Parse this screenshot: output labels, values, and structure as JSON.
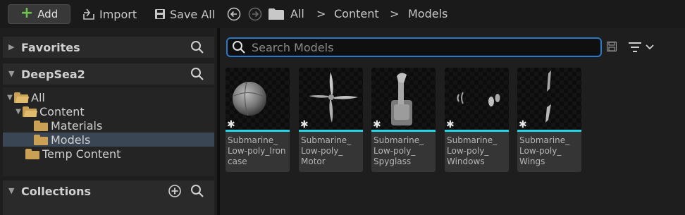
{
  "toolbar": {
    "add_label": "Add",
    "import_label": "Import",
    "save_all_label": "Save All",
    "breadcrumb": [
      "All",
      "Content",
      "Models"
    ],
    "separator": ">"
  },
  "left_panel": {
    "favorites_label": "Favorites",
    "project_label": "DeepSea2",
    "tree": [
      {
        "label": "All",
        "level": 0,
        "expanded": true,
        "selected": false
      },
      {
        "label": "Content",
        "level": 1,
        "expanded": true,
        "selected": false
      },
      {
        "label": "Materials",
        "level": 2,
        "expanded": false,
        "selected": false
      },
      {
        "label": "Models",
        "level": 2,
        "expanded": false,
        "selected": true
      },
      {
        "label": "Temp Content",
        "level": 1,
        "expanded": false,
        "selected": false
      }
    ],
    "collections_label": "Collections"
  },
  "content": {
    "search_placeholder": "Search Models",
    "assets": [
      {
        "name": "Submarine_\nLow-poly_Iron\ncase",
        "thumb": "sphere-icon"
      },
      {
        "name": "Submarine_\nLow-poly_\nMotor",
        "thumb": "propeller-icon"
      },
      {
        "name": "Submarine_\nLow-poly_\nSpyglass",
        "thumb": "periscope-icon"
      },
      {
        "name": "Submarine_\nLow-poly_\nWindows",
        "thumb": "windows-icon"
      },
      {
        "name": "Submarine_\nLow-poly_\nWings",
        "thumb": "wings-icon"
      }
    ]
  },
  "colors": {
    "accent": "#2a78c8",
    "asset_strip": "#1ed7e6",
    "folder": "#c9a054",
    "add_plus": "#6cc24a",
    "selection": "#3b4654"
  }
}
